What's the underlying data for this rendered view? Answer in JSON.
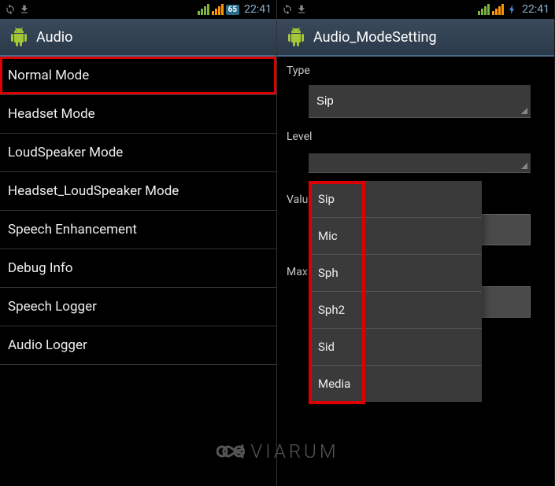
{
  "left": {
    "status": {
      "battery": "65",
      "time": "22:41"
    },
    "title": "Audio",
    "items": [
      {
        "label": "Normal Mode",
        "highlighted": true
      },
      {
        "label": "Headset Mode",
        "highlighted": false
      },
      {
        "label": "LoudSpeaker Mode",
        "highlighted": false
      },
      {
        "label": "Headset_LoudSpeaker Mode",
        "highlighted": false
      },
      {
        "label": "Speech Enhancement",
        "highlighted": false
      },
      {
        "label": "Debug Info",
        "highlighted": false
      },
      {
        "label": "Speech Logger",
        "highlighted": false
      },
      {
        "label": "Audio Logger",
        "highlighted": false
      }
    ]
  },
  "right": {
    "status": {
      "time": "22:41"
    },
    "title": "Audio_ModeSetting",
    "form": {
      "type_label": "Type",
      "type_value": "Sip",
      "level_label": "Level",
      "value_label": "Value",
      "max_label": "Max V"
    },
    "dropdown": [
      "Sip",
      "Mic",
      "Sph",
      "Sph2",
      "Sid",
      "Media"
    ]
  },
  "watermark": "VIARUM"
}
